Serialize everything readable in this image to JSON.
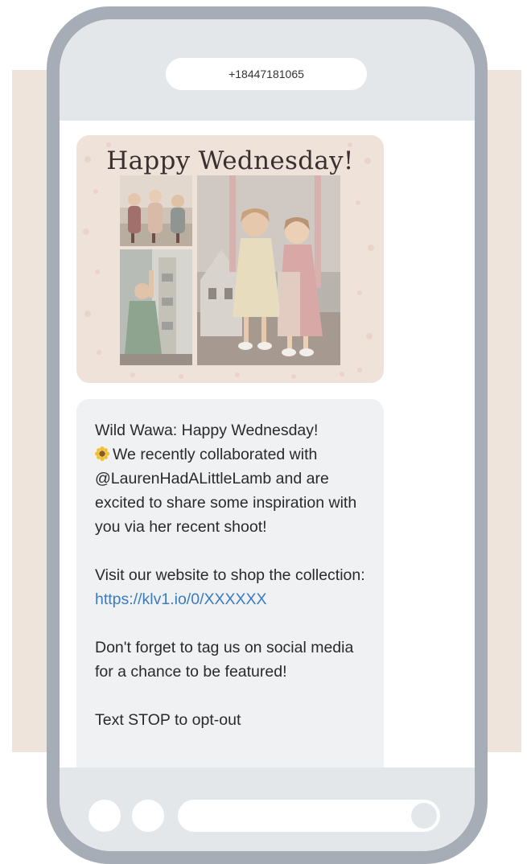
{
  "header": {
    "phone_number": "+18447181065"
  },
  "mms": {
    "title": "Happy Wednesday!",
    "photos": [
      "photo-three-girls",
      "photo-girl-with-dollhouse",
      "photo-two-girls-on-swing"
    ]
  },
  "message": {
    "line1": "Wild Wawa: Happy Wednesday!",
    "emoji_icon": "sunflower-icon",
    "line2": "We recently collaborated with @LaurenHadALittleLamb and are excited to share some inspiration with you via her recent shoot!",
    "shop_text": "Visit our website to shop the collection:",
    "link": "https://klv1.io/0/XXXXXX",
    "social_text": "Don't forget to tag us on social media for a chance to be featured!",
    "optout_text": "Text STOP to opt-out"
  },
  "colors": {
    "backdrop": "#efe4dc",
    "phone_frame": "#a7adb6",
    "screen_chrome": "#e4e7ea",
    "bubble": "#f0f1f3",
    "mms_bg": "#efe2d8",
    "link": "#3b7bbf"
  }
}
